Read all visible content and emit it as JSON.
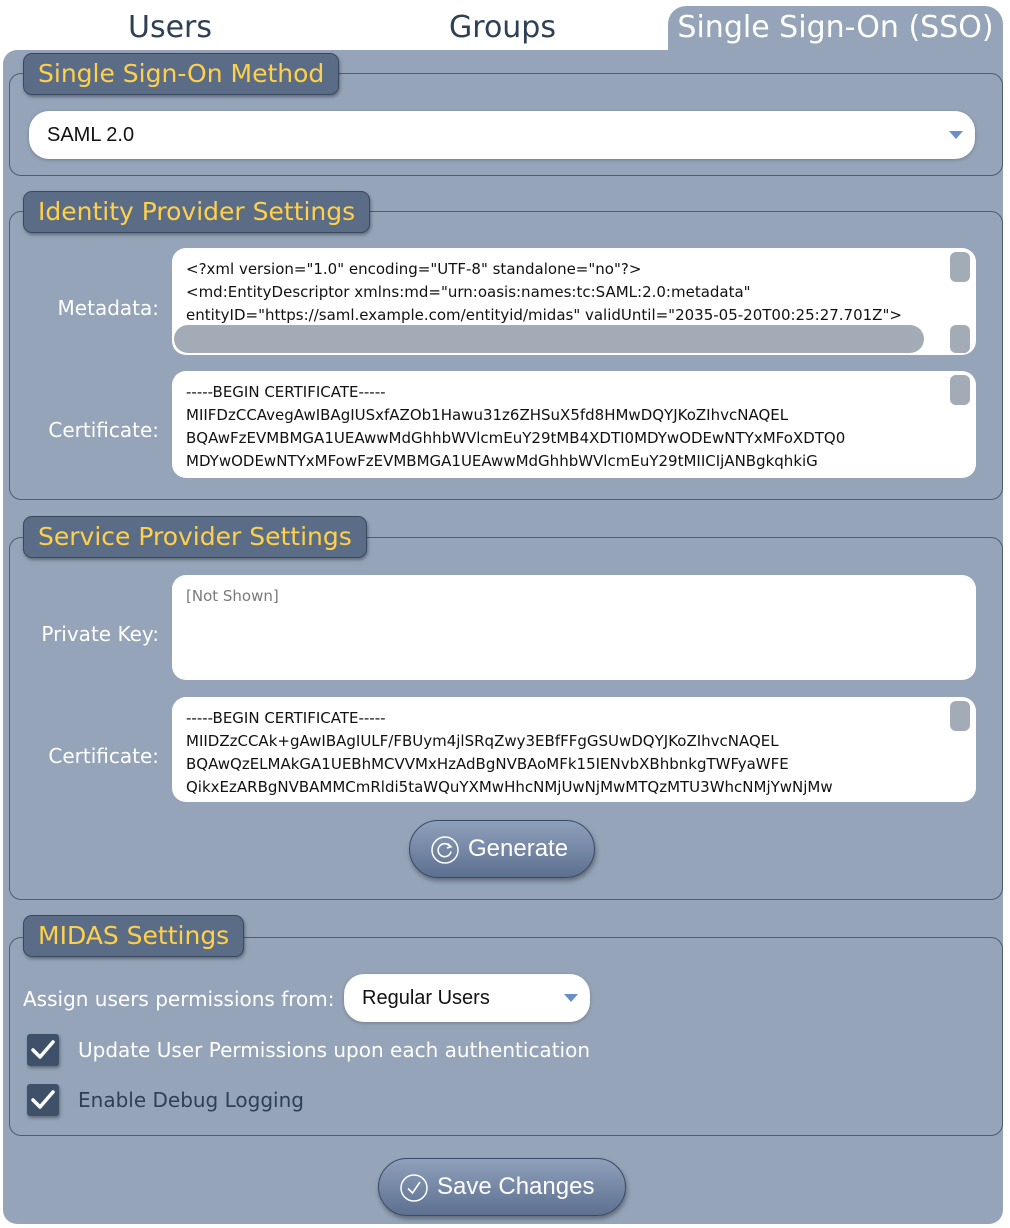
{
  "tabs": [
    {
      "label": "Users"
    },
    {
      "label": "Groups"
    },
    {
      "label": "Single Sign-On (SSO)"
    }
  ],
  "sso_method": {
    "legend": "Single Sign-On Method",
    "selected": "SAML 2.0"
  },
  "identity_provider": {
    "legend": "Identity Provider Settings",
    "metadata_label": "Metadata:",
    "metadata_lines": [
      "<?xml version=\"1.0\" encoding=\"UTF-8\" standalone=\"no\"?>",
      "<md:EntityDescriptor xmlns:md=\"urn:oasis:names:tc:SAML:2.0:metadata\"",
      "entityID=\"https://saml.example.com/entityid/midas\" validUntil=\"2035-05-20T00:25:27.701Z\">"
    ],
    "certificate_label": "Certificate:",
    "certificate_lines": [
      "-----BEGIN CERTIFICATE-----",
      "MIIFDzCCAvegAwIBAgIUSxfAZOb1Hawu31z6ZHSuX5fd8HMwDQYJKoZIhvcNAQEL",
      "BQAwFzEVMBMGA1UEAwwMdGhhbWVlcmEuY29tMB4XDTI0MDYwODEwNTYxMFoXDTQ0",
      "MDYwODEwNTYxMFowFzEVMBMGA1UEAwwMdGhhbWVlcmEuY29tMIICIjANBgkqhkiG"
    ]
  },
  "service_provider": {
    "legend": "Service Provider Settings",
    "private_key_label": "Private Key:",
    "private_key_placeholder": "[Not Shown]",
    "certificate_label": "Certificate:",
    "certificate_lines": [
      "-----BEGIN CERTIFICATE-----",
      "MIIDZzCCAk+gAwIBAgIULF/FBUym4jlSRqZwy3EBfFFgGSUwDQYJKoZIhvcNAQEL",
      "BQAwQzELMAkGA1UEBhMCVVMxHzAdBgNVBAoMFk15IENvbXBhbnkgTWFyaWFE",
      "QikxEzARBgNVBAMMCmRldi5taWQuYXMwHhcNMjUwNjMwMTQzMTU3WhcNMjYwNjMw"
    ],
    "generate_label": "Generate"
  },
  "midas": {
    "legend": "MIDAS Settings",
    "assign_label": "Assign users permissions from:",
    "assign_selected": "Regular Users",
    "update_permissions_label": "Update User Permissions upon each authentication",
    "update_permissions_checked": true,
    "debug_logging_label": "Enable Debug Logging",
    "debug_logging_checked": true
  },
  "save_label": "Save Changes",
  "colors": {
    "panel": "#95a4b9",
    "legend_bg": "#5b6d86",
    "legend_text": "#ffd04a",
    "button": "#5d7090"
  }
}
